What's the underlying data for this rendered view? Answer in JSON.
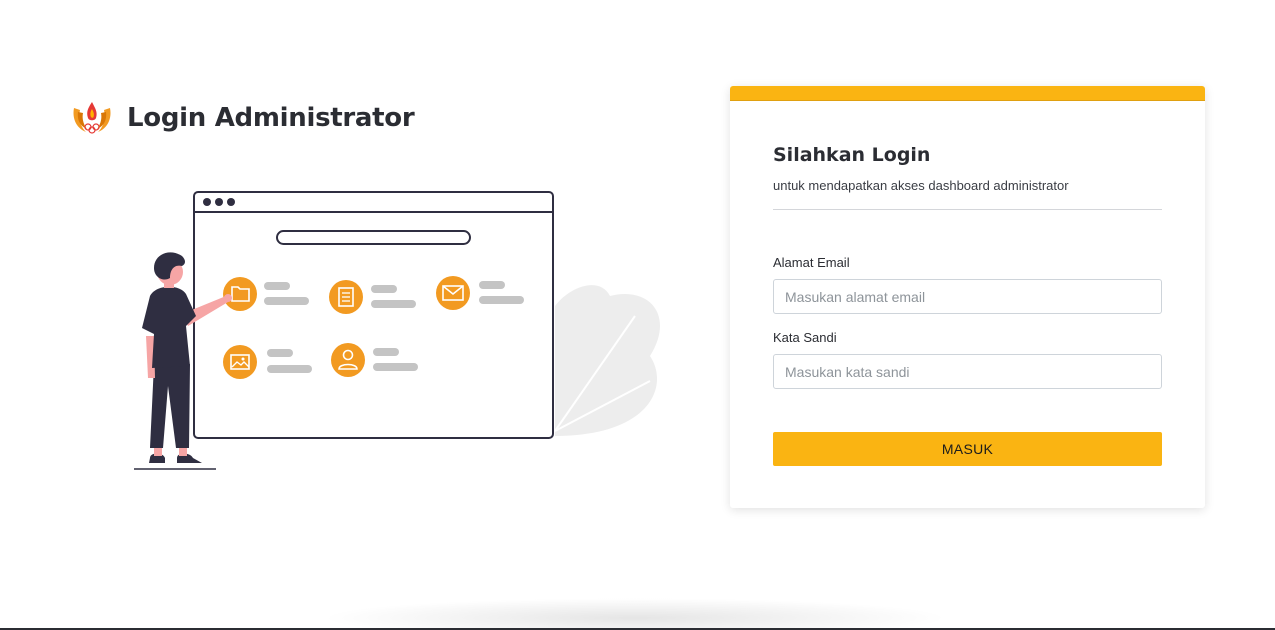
{
  "header": {
    "title": "Login Administrator",
    "logo_icon": "flame-emblem-logo"
  },
  "login_card": {
    "accent_color": "#fab412",
    "title": "Silahkan Login",
    "subtitle": "untuk mendapatkan akses dashboard administrator",
    "email": {
      "label": "Alamat Email",
      "value": "",
      "placeholder": "Masukan alamat email"
    },
    "password": {
      "label": "Kata Sandi",
      "value": "",
      "placeholder": "Masukan kata sandi"
    },
    "submit_label": "MASUK"
  },
  "illustration": {
    "icons": [
      "folder-icon",
      "document-icon",
      "mail-icon",
      "image-icon",
      "user-icon"
    ],
    "icon_color": "#f29a21"
  }
}
